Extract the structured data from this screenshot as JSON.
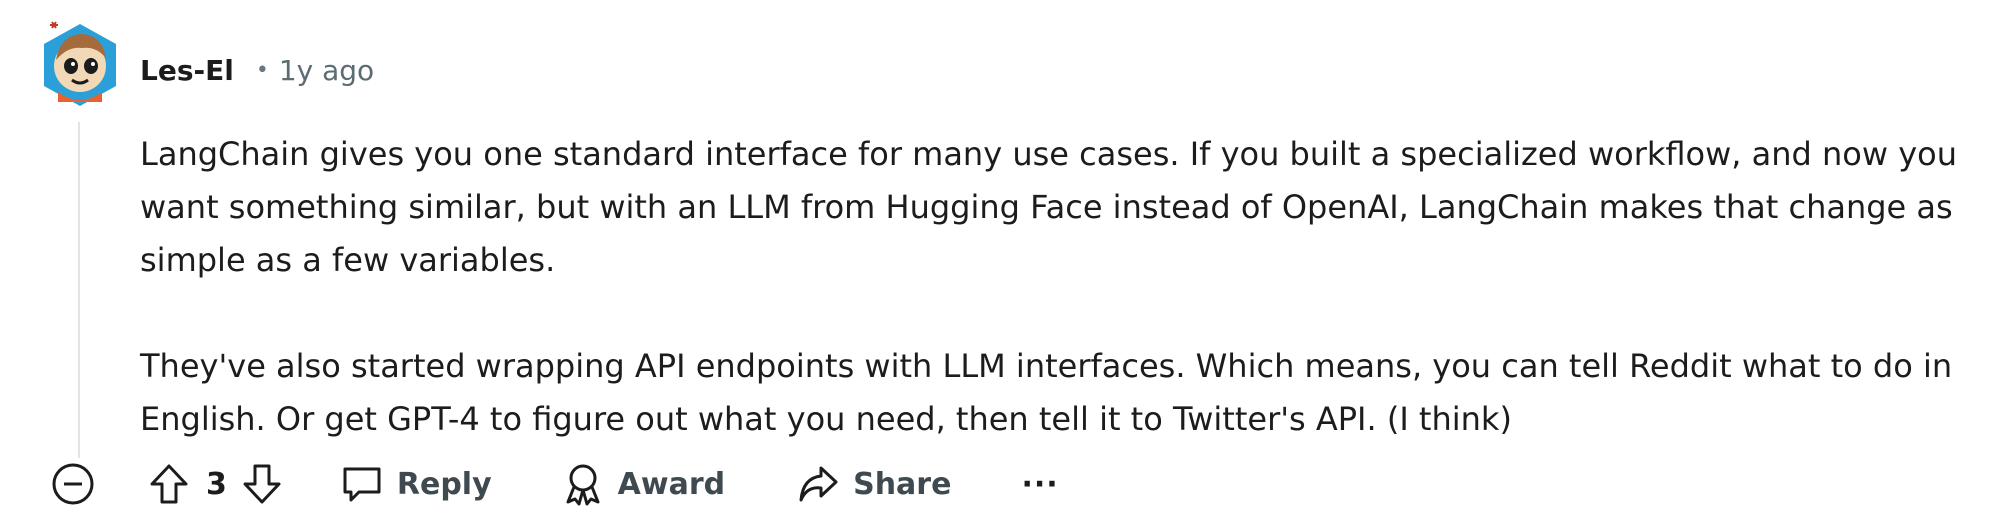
{
  "comment": {
    "author": "Les-El",
    "separator": "•",
    "age": "1y ago",
    "paragraphs": [
      {
        "line1": "LangChain gives you one standard interface for many use cases. If you built a specialized workflow, and now you",
        "line2": "want something similar, but with an LLM from Hugging Face instead of OpenAI, LangChain makes that change as",
        "line3": "simple as a few variables."
      },
      {
        "line1": "They've also started wrapping API endpoints with LLM interfaces. Which means, you can tell Reddit what to do in",
        "line2": "English. Or get GPT-4 to figure out what you need, then tell it to Twitter's API. (I think)"
      }
    ]
  },
  "actions": {
    "collapse_icon": "minus-circle-icon",
    "upvote_icon": "arrow-up-icon",
    "score": "3",
    "downvote_icon": "arrow-down-icon",
    "reply_label": "Reply",
    "award_label": "Award",
    "share_label": "Share",
    "more_label": "···"
  },
  "colors": {
    "text": "#1c1c1c",
    "muted": "#5c6c74",
    "thread_line": "#e1e4e6",
    "avatar_bg": "#2b9fd8",
    "avatar_accent": "#e8642c"
  }
}
